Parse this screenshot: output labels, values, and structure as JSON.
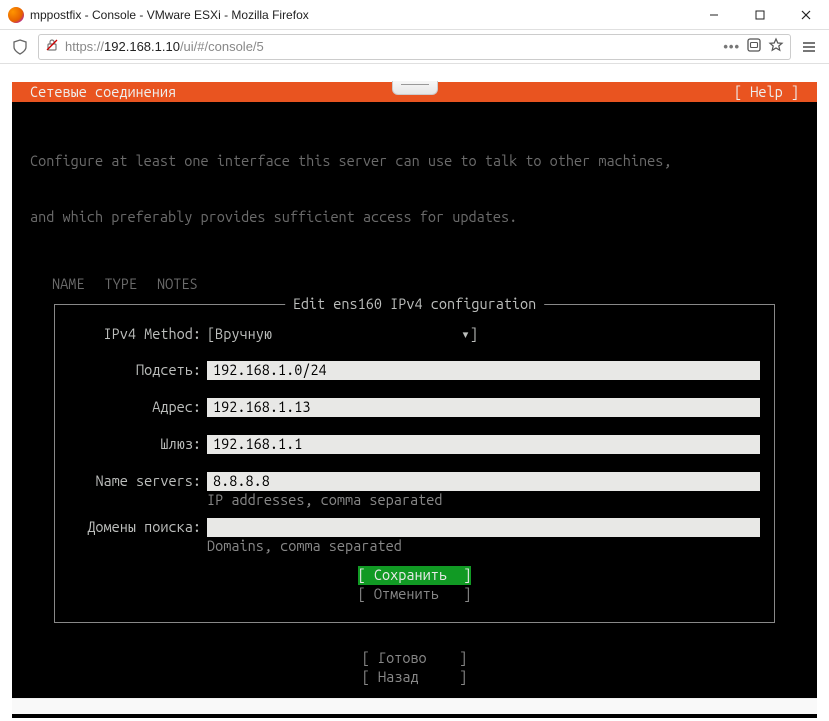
{
  "window": {
    "title": "mppostfix - Console - VMware ESXi - Mozilla Firefox"
  },
  "url": {
    "protocol": "https://",
    "host": "192.168.1.10",
    "rest": "/ui/#/console/5"
  },
  "header": {
    "title": "Сетевые соединения",
    "help": "[ Help ]"
  },
  "intro": {
    "line1": "Configure at least one interface this server can use to talk to other machines,",
    "line2": "and which preferably provides sufficient access for updates."
  },
  "list": {
    "col1": "NAME",
    "col2": "TYPE",
    "col3": "NOTES"
  },
  "dialog": {
    "title": "Edit ens160 IPv4 configuration",
    "method": {
      "label": "IPv4 Method:",
      "value": "Вручную"
    },
    "subnet": {
      "label": "Подсеть:",
      "value": "192.168.1.0/24"
    },
    "address": {
      "label": "Адрес:",
      "value": "192.168.1.13"
    },
    "gateway": {
      "label": "Шлюз:",
      "value": "192.168.1.1"
    },
    "nameservers": {
      "label": "Name servers:",
      "value": "8.8.8.8",
      "hint": "IP addresses, comma separated"
    },
    "searchdomains": {
      "label": "Домены поиска:",
      "value": "",
      "hint": "Domains, comma separated"
    },
    "save": "[ Сохранить  ]",
    "cancel": "[ Отменить   ]"
  },
  "footer": {
    "done": "[ Готово    ]",
    "back": "[ Назад     ]"
  }
}
